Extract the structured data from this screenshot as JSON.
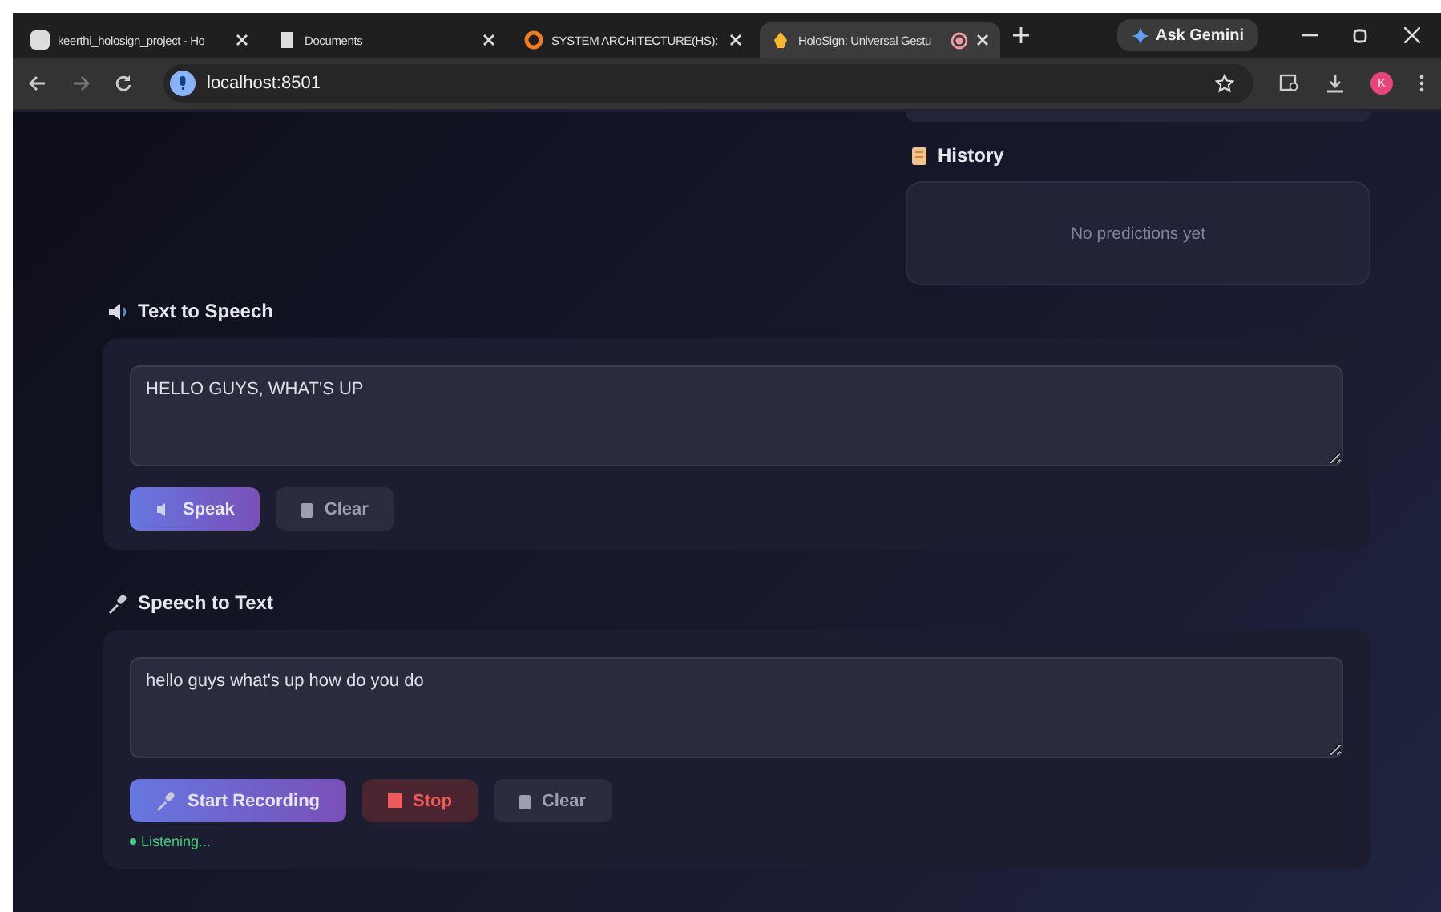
{
  "browser": {
    "tabs": [
      {
        "title": "keerthi_holosign_project - Ho",
        "selected": false,
        "recording": false
      },
      {
        "title": "Documents",
        "selected": false,
        "recording": false
      },
      {
        "title": "SYSTEM ARCHITECTURE(HS): ",
        "selected": false,
        "recording": false
      },
      {
        "title": "HoloSign: Universal Gestu",
        "selected": true,
        "recording": true
      }
    ],
    "ask_button": "Ask Gemini",
    "url": "localhost:8501",
    "profile_initial": "K"
  },
  "history": {
    "title": "History",
    "empty_text": "No predictions yet"
  },
  "tts": {
    "title": "Text to Speech",
    "value": "HELLO GUYS, WHAT'S UP",
    "buttons": [
      {
        "label": "Speak",
        "kind": "primary"
      },
      {
        "label": "Clear",
        "kind": "secondary"
      }
    ]
  },
  "stt": {
    "title": "Speech to Text",
    "value": "hello guys what's up how do you do",
    "buttons": [
      {
        "label": "Start Recording",
        "kind": "primary"
      },
      {
        "label": "Stop",
        "kind": "danger"
      },
      {
        "label": "Clear",
        "kind": "secondary"
      }
    ],
    "status": "Listening..."
  }
}
